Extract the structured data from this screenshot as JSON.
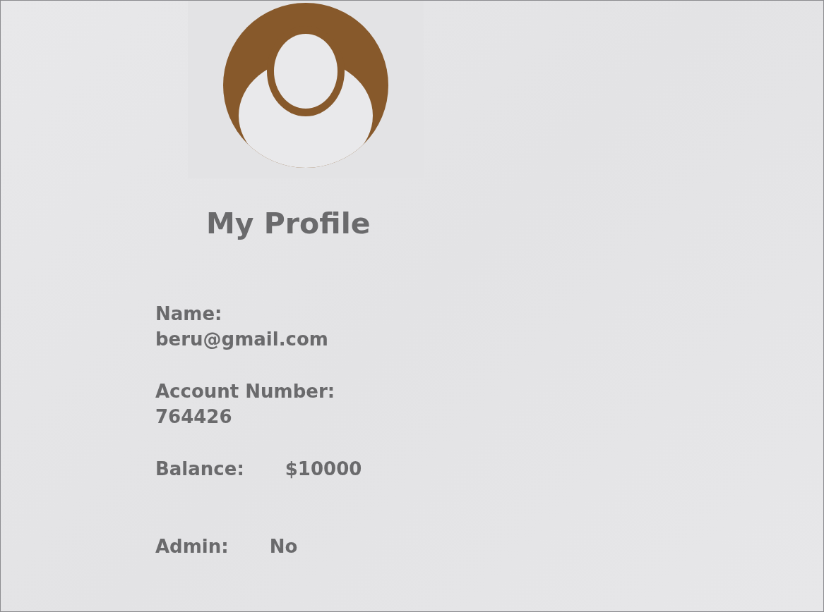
{
  "title": "My Profile",
  "fields": [
    {
      "kind": "stacked",
      "label": "Name:",
      "value": "beru@gmail.com"
    },
    {
      "kind": "stacked",
      "label": "Account Number:",
      "value": "764426"
    },
    {
      "kind": "inline",
      "label": "Balance:",
      "value": "$10000"
    },
    {
      "kind": "inline",
      "label": "Admin:",
      "value": "No"
    }
  ]
}
